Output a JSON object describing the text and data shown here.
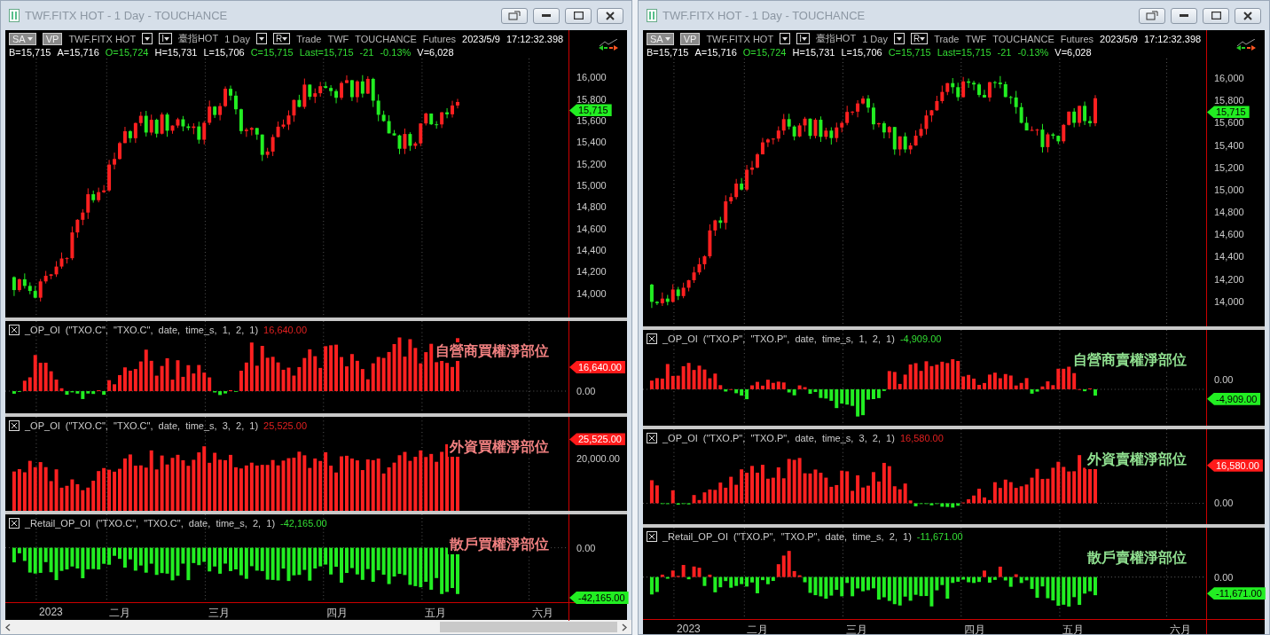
{
  "windows": [
    {
      "title": "TWF.FITX HOT - 1 Day - TOUCHANCE",
      "kind": "call",
      "toolbar": {
        "mode": "SA",
        "vp": "VP",
        "symbol": "TWF.FITX HOT",
        "chart_type": "I",
        "alias": "臺指HOT",
        "period": "1 Day",
        "r": "R",
        "fields": [
          "Trade",
          "TWF",
          "TOUCHANCE",
          "Futures",
          "2023/5/9",
          "17:12:32.398"
        ]
      },
      "quote": [
        {
          "text": "B=15,715",
          "kind": "plain"
        },
        {
          "text": "A=15,716",
          "kind": "plain"
        },
        {
          "text": "O=15,724",
          "kind": "down"
        },
        {
          "text": "H=15,731",
          "kind": "plain"
        },
        {
          "text": "L=15,706",
          "kind": "plain"
        },
        {
          "text": "C=15,715",
          "kind": "down"
        },
        {
          "text": "Last=15,715",
          "kind": "down"
        },
        {
          "text": "-21",
          "kind": "down"
        },
        {
          "text": "-0.13%",
          "kind": "down"
        },
        {
          "text": "V=6,028",
          "kind": "plain"
        }
      ],
      "price_axis": [
        "16,000",
        "15,800",
        "15,600",
        "15,400",
        "15,200",
        "15,000",
        "14,800",
        "14,600",
        "14,400",
        "14,200",
        "14,000"
      ],
      "last_price": "15,715",
      "panes": [
        {
          "name": "_OP_OI",
          "params": "(\"TXO.C\",  \"TXO.C\",  date,  time_s,  1,  2,  1)",
          "value": "16,640.00",
          "kind": "up",
          "label": "自營商買權淨部位",
          "axis": [
            "0.00"
          ],
          "badge": "16,640.00"
        },
        {
          "name": "_OP_OI",
          "params": "(\"TXO.C\",  \"TXO.C\",  date,  time_s,  3,  2,  1)",
          "value": "25,525.00",
          "kind": "up",
          "label": "外資買權淨部位",
          "axis": [
            "20,000.00"
          ],
          "badge": "25,525.00"
        },
        {
          "name": "_Retail_OP_OI",
          "params": "(\"TXO.C\",  \"TXO.C\",  date,  time_s,  2,  1)",
          "value": "-42,165.00",
          "kind": "down",
          "label": "散戶買權淨部位",
          "axis": [
            "0.00"
          ],
          "badge": "-42,165.00"
        }
      ],
      "x_axis": [
        "2023",
        "二月",
        "三月",
        "四月",
        "五月",
        "六月"
      ],
      "scrollbar": true
    },
    {
      "title": "TWF.FITX HOT - 1 Day - TOUCHANCE",
      "kind": "put",
      "toolbar": {
        "mode": "SA",
        "vp": "VP",
        "symbol": "TWF.FITX HOT",
        "chart_type": "I",
        "alias": "臺指HOT",
        "period": "1 Day",
        "r": "R",
        "fields": [
          "Trade",
          "TWF",
          "TOUCHANCE",
          "Futures",
          "2023/5/9",
          "17:12:32.398"
        ]
      },
      "quote": [
        {
          "text": "B=15,715",
          "kind": "plain"
        },
        {
          "text": "A=15,716",
          "kind": "plain"
        },
        {
          "text": "O=15,724",
          "kind": "down"
        },
        {
          "text": "H=15,731",
          "kind": "plain"
        },
        {
          "text": "L=15,706",
          "kind": "plain"
        },
        {
          "text": "C=15,715",
          "kind": "down"
        },
        {
          "text": "Last=15,715",
          "kind": "down"
        },
        {
          "text": "-21",
          "kind": "down"
        },
        {
          "text": "-0.13%",
          "kind": "down"
        },
        {
          "text": "V=6,028",
          "kind": "plain"
        }
      ],
      "price_axis": [
        "16,000",
        "15,800",
        "15,600",
        "15,400",
        "15,200",
        "15,000",
        "14,800",
        "14,600",
        "14,400",
        "14,200",
        "14,000"
      ],
      "last_price": "15,715",
      "panes": [
        {
          "name": "_OP_OI",
          "params": "(\"TXO.P\",  \"TXO.P\",  date,  time_s,  1,  2,  1)",
          "value": "-4,909.00",
          "kind": "down",
          "label": "自營商賣權淨部位",
          "axis": [
            "0.00"
          ],
          "badge": "-4,909.00"
        },
        {
          "name": "_OP_OI",
          "params": "(\"TXO.P\",  \"TXO.P\",  date,  time_s,  3,  2,  1)",
          "value": "16,580.00",
          "kind": "up",
          "label": "外資賣權淨部位",
          "axis": [
            "0.00"
          ],
          "badge": "16,580.00"
        },
        {
          "name": "_Retail_OP_OI",
          "params": "(\"TXO.P\",  \"TXO.P\",  date,  time_s,  2,  1)",
          "value": "-11,671.00",
          "kind": "down",
          "label": "散戶賣權淨部位",
          "axis": [
            "0.00"
          ],
          "badge": "-11,671.00"
        }
      ],
      "x_axis": [
        "2023",
        "二月",
        "三月",
        "四月",
        "五月",
        "六月"
      ],
      "scrollbar": false
    }
  ]
}
